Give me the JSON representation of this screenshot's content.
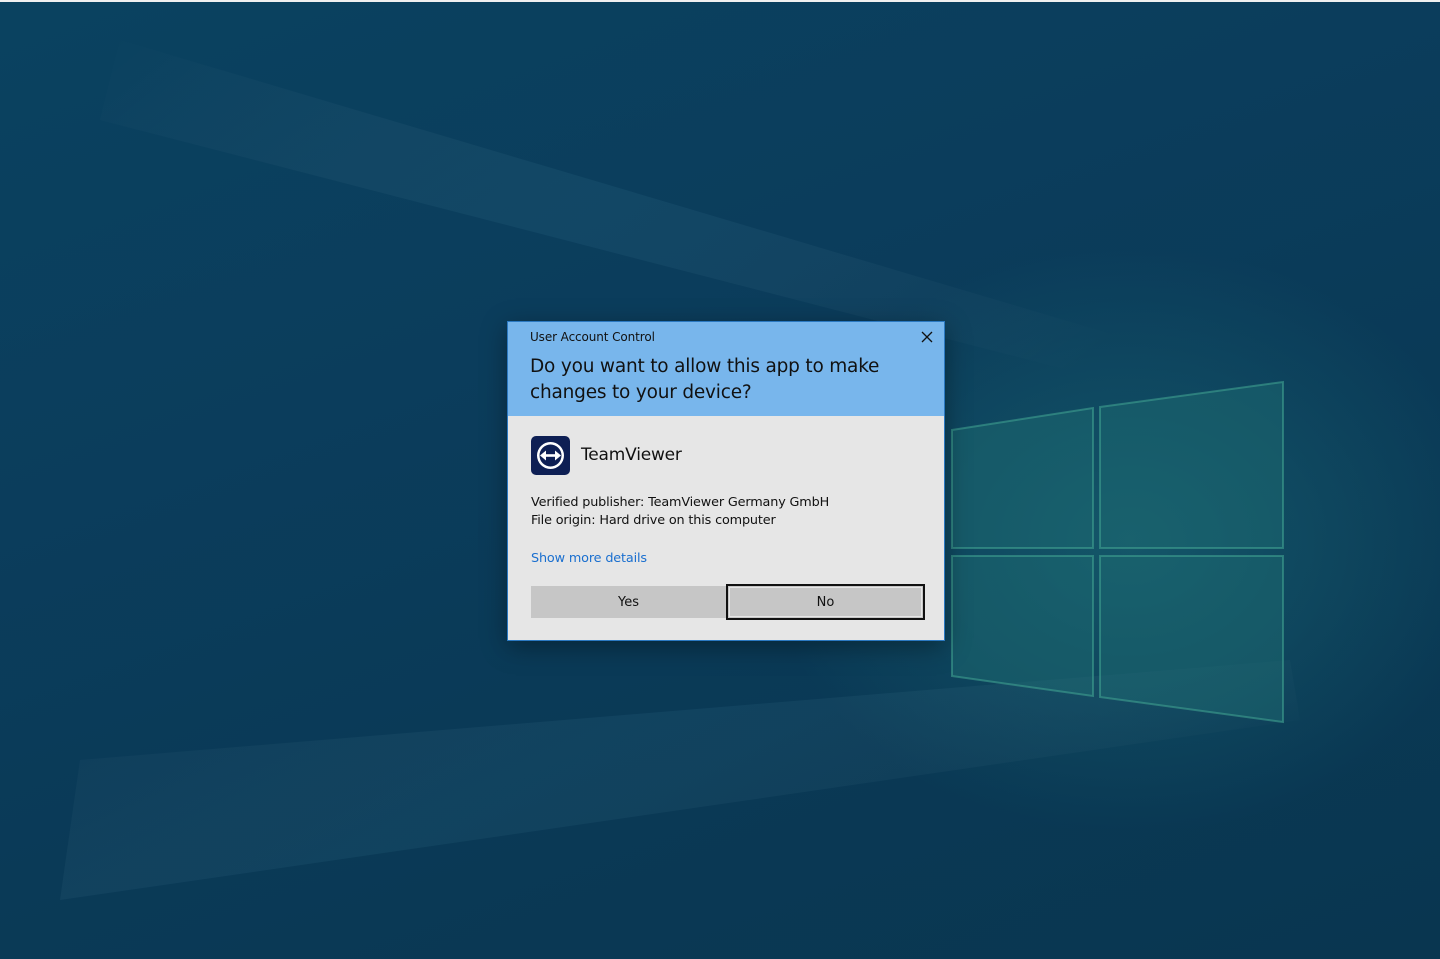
{
  "dialog": {
    "caption": "User Account Control",
    "question": "Do you want to allow this app to make changes to your device?",
    "app_name": "TeamViewer",
    "publisher": "Verified publisher: TeamViewer Germany GmbH",
    "origin": "File origin: Hard drive on this computer",
    "details_link": "Show more details",
    "yes_label": "Yes",
    "no_label": "No",
    "header_color": "#78b6ec",
    "body_color": "#e6e6e6",
    "link_color": "#1a6fcf",
    "app_icon": "teamviewer-logo-icon"
  },
  "desktop": {
    "background_color": "#0b3f5f",
    "wallpaper_logo": "windows-logo"
  }
}
